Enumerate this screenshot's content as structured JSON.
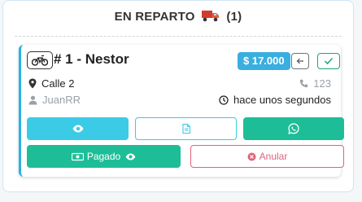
{
  "header": {
    "status": "EN REPARTO",
    "count": "(1)"
  },
  "order": {
    "title": "# 1 - Nestor",
    "price": "$ 17.000",
    "address": "Calle 2",
    "phone": "123",
    "user": "JuanRR",
    "time": "hace unos segundos"
  },
  "actions": {
    "paid_label": "Pagado",
    "cancel_label": "Anular"
  },
  "colors": {
    "price_badge": "#3aaee0",
    "view_button": "#3bcbe6",
    "whatsapp_button": "#1dbe97",
    "paid_button": "#1dbe97",
    "cancel_button": "#e06479",
    "card_accent": "#29b3e2"
  },
  "icons": {
    "status": "delivery-truck-icon",
    "order_type": "bicycle-icon",
    "address": "map-pin-icon",
    "phone": "phone-icon",
    "user": "user-icon",
    "time": "clock-icon"
  }
}
